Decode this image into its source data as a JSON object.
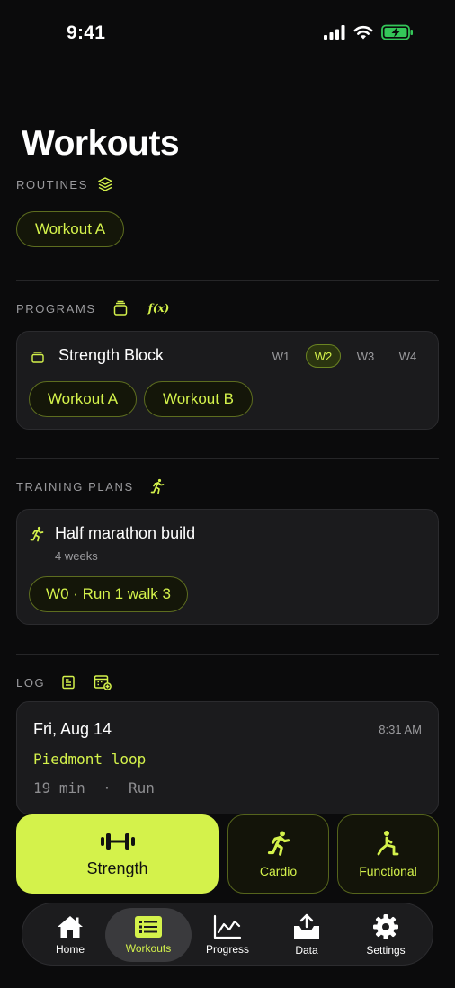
{
  "status_bar": {
    "time": "9:41"
  },
  "page": {
    "title": "Workouts"
  },
  "routines": {
    "label": "ROUTINES",
    "icon": "layers-icon",
    "items": [
      "Workout A"
    ]
  },
  "programs": {
    "label": "PROGRAMS",
    "fx_label": "f(x)",
    "card": {
      "title": "Strength Block",
      "weeks": [
        "W1",
        "W2",
        "W3",
        "W4"
      ],
      "active_week": "W2",
      "workouts": [
        "Workout A",
        "Workout B"
      ]
    }
  },
  "training_plans": {
    "label": "TRAINING PLANS",
    "card": {
      "title": "Half marathon build",
      "duration": "4 weeks",
      "session": "W0 · Run 1 walk 3"
    }
  },
  "log": {
    "label": "LOG",
    "entry": {
      "date": "Fri, Aug 14",
      "time": "8:31 AM",
      "name": "Piedmont loop",
      "meta": "19 min  ·  Run"
    }
  },
  "quick_actions": {
    "strength": "Strength",
    "cardio": "Cardio",
    "functional": "Functional"
  },
  "tabs": {
    "home": "Home",
    "workouts": "Workouts",
    "progress": "Progress",
    "data": "Data",
    "settings": "Settings",
    "active": "Workouts"
  },
  "colors": {
    "accent": "#d4f24b",
    "background": "#0b0b0c",
    "card": "#1b1b1d",
    "muted_text": "#9a9a9d",
    "battery": "#34c759"
  }
}
